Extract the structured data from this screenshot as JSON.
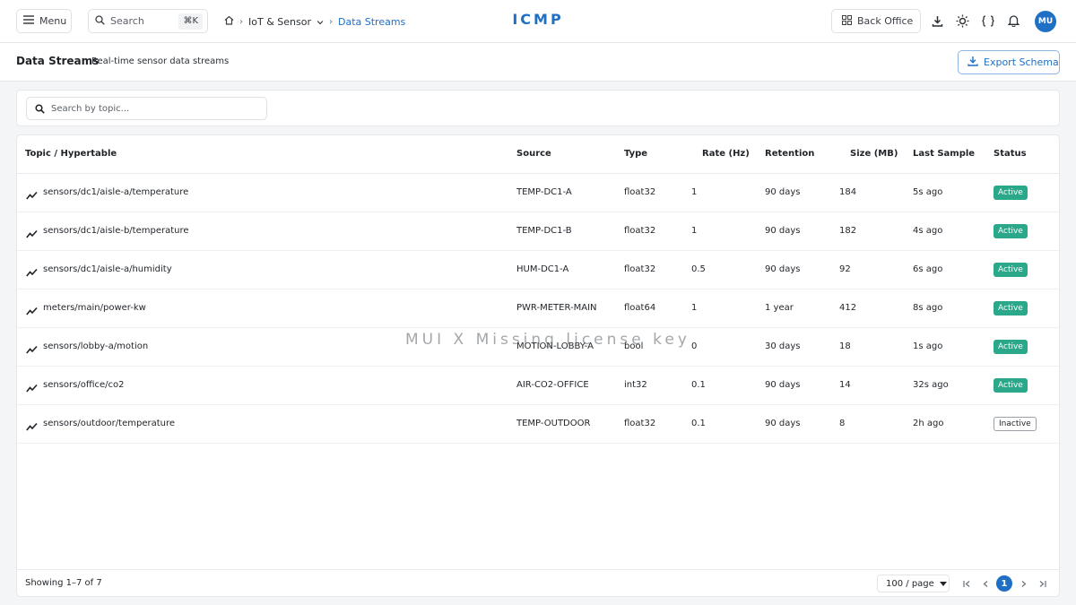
{
  "topbar": {
    "menu_label": "Menu",
    "search_label": "Search",
    "search_shortcut": "⌘K",
    "breadcrumb": {
      "section": "IoT & Sensor",
      "current": "Data Streams"
    },
    "brand": "ICMP",
    "back_office_label": "Back Office",
    "avatar_initials": "MU"
  },
  "page": {
    "title": "Data Streams",
    "subtitle": "Real-time sensor data streams",
    "export_label": "Export Schema"
  },
  "filter": {
    "placeholder": "Search by topic..."
  },
  "table": {
    "columns": {
      "topic": "Topic / Hypertable",
      "source": "Source",
      "type": "Type",
      "rate": "Rate (Hz)",
      "retention": "Retention",
      "size": "Size (MB)",
      "last_sample": "Last Sample",
      "status": "Status"
    },
    "rows": [
      {
        "topic": "sensors/dc1/aisle-a/temperature",
        "source": "TEMP-DC1-A",
        "type": "float32",
        "rate": "1",
        "retention": "90 days",
        "size": "184",
        "last_sample": "5s ago",
        "status": "Active"
      },
      {
        "topic": "sensors/dc1/aisle-b/temperature",
        "source": "TEMP-DC1-B",
        "type": "float32",
        "rate": "1",
        "retention": "90 days",
        "size": "182",
        "last_sample": "4s ago",
        "status": "Active"
      },
      {
        "topic": "sensors/dc1/aisle-a/humidity",
        "source": "HUM-DC1-A",
        "type": "float32",
        "rate": "0.5",
        "retention": "90 days",
        "size": "92",
        "last_sample": "6s ago",
        "status": "Active"
      },
      {
        "topic": "meters/main/power-kw",
        "source": "PWR-METER-MAIN",
        "type": "float64",
        "rate": "1",
        "retention": "1 year",
        "size": "412",
        "last_sample": "8s ago",
        "status": "Active"
      },
      {
        "topic": "sensors/lobby-a/motion",
        "source": "MOTION-LOBBY-A",
        "type": "bool",
        "rate": "0",
        "retention": "30 days",
        "size": "18",
        "last_sample": "1s ago",
        "status": "Active"
      },
      {
        "topic": "sensors/office/co2",
        "source": "AIR-CO2-OFFICE",
        "type": "int32",
        "rate": "0.1",
        "retention": "90 days",
        "size": "14",
        "last_sample": "32s ago",
        "status": "Active"
      },
      {
        "topic": "sensors/outdoor/temperature",
        "source": "TEMP-OUTDOOR",
        "type": "float32",
        "rate": "0.1",
        "retention": "90 days",
        "size": "8",
        "last_sample": "2h ago",
        "status": "Inactive"
      }
    ]
  },
  "footer": {
    "showing": "Showing 1–7 of 7",
    "per_page": "100 / page",
    "current_page": "1"
  },
  "watermark": "MUI X Missing license key",
  "colors": {
    "accent": "#1f6fc5",
    "active": "#2aa889"
  }
}
